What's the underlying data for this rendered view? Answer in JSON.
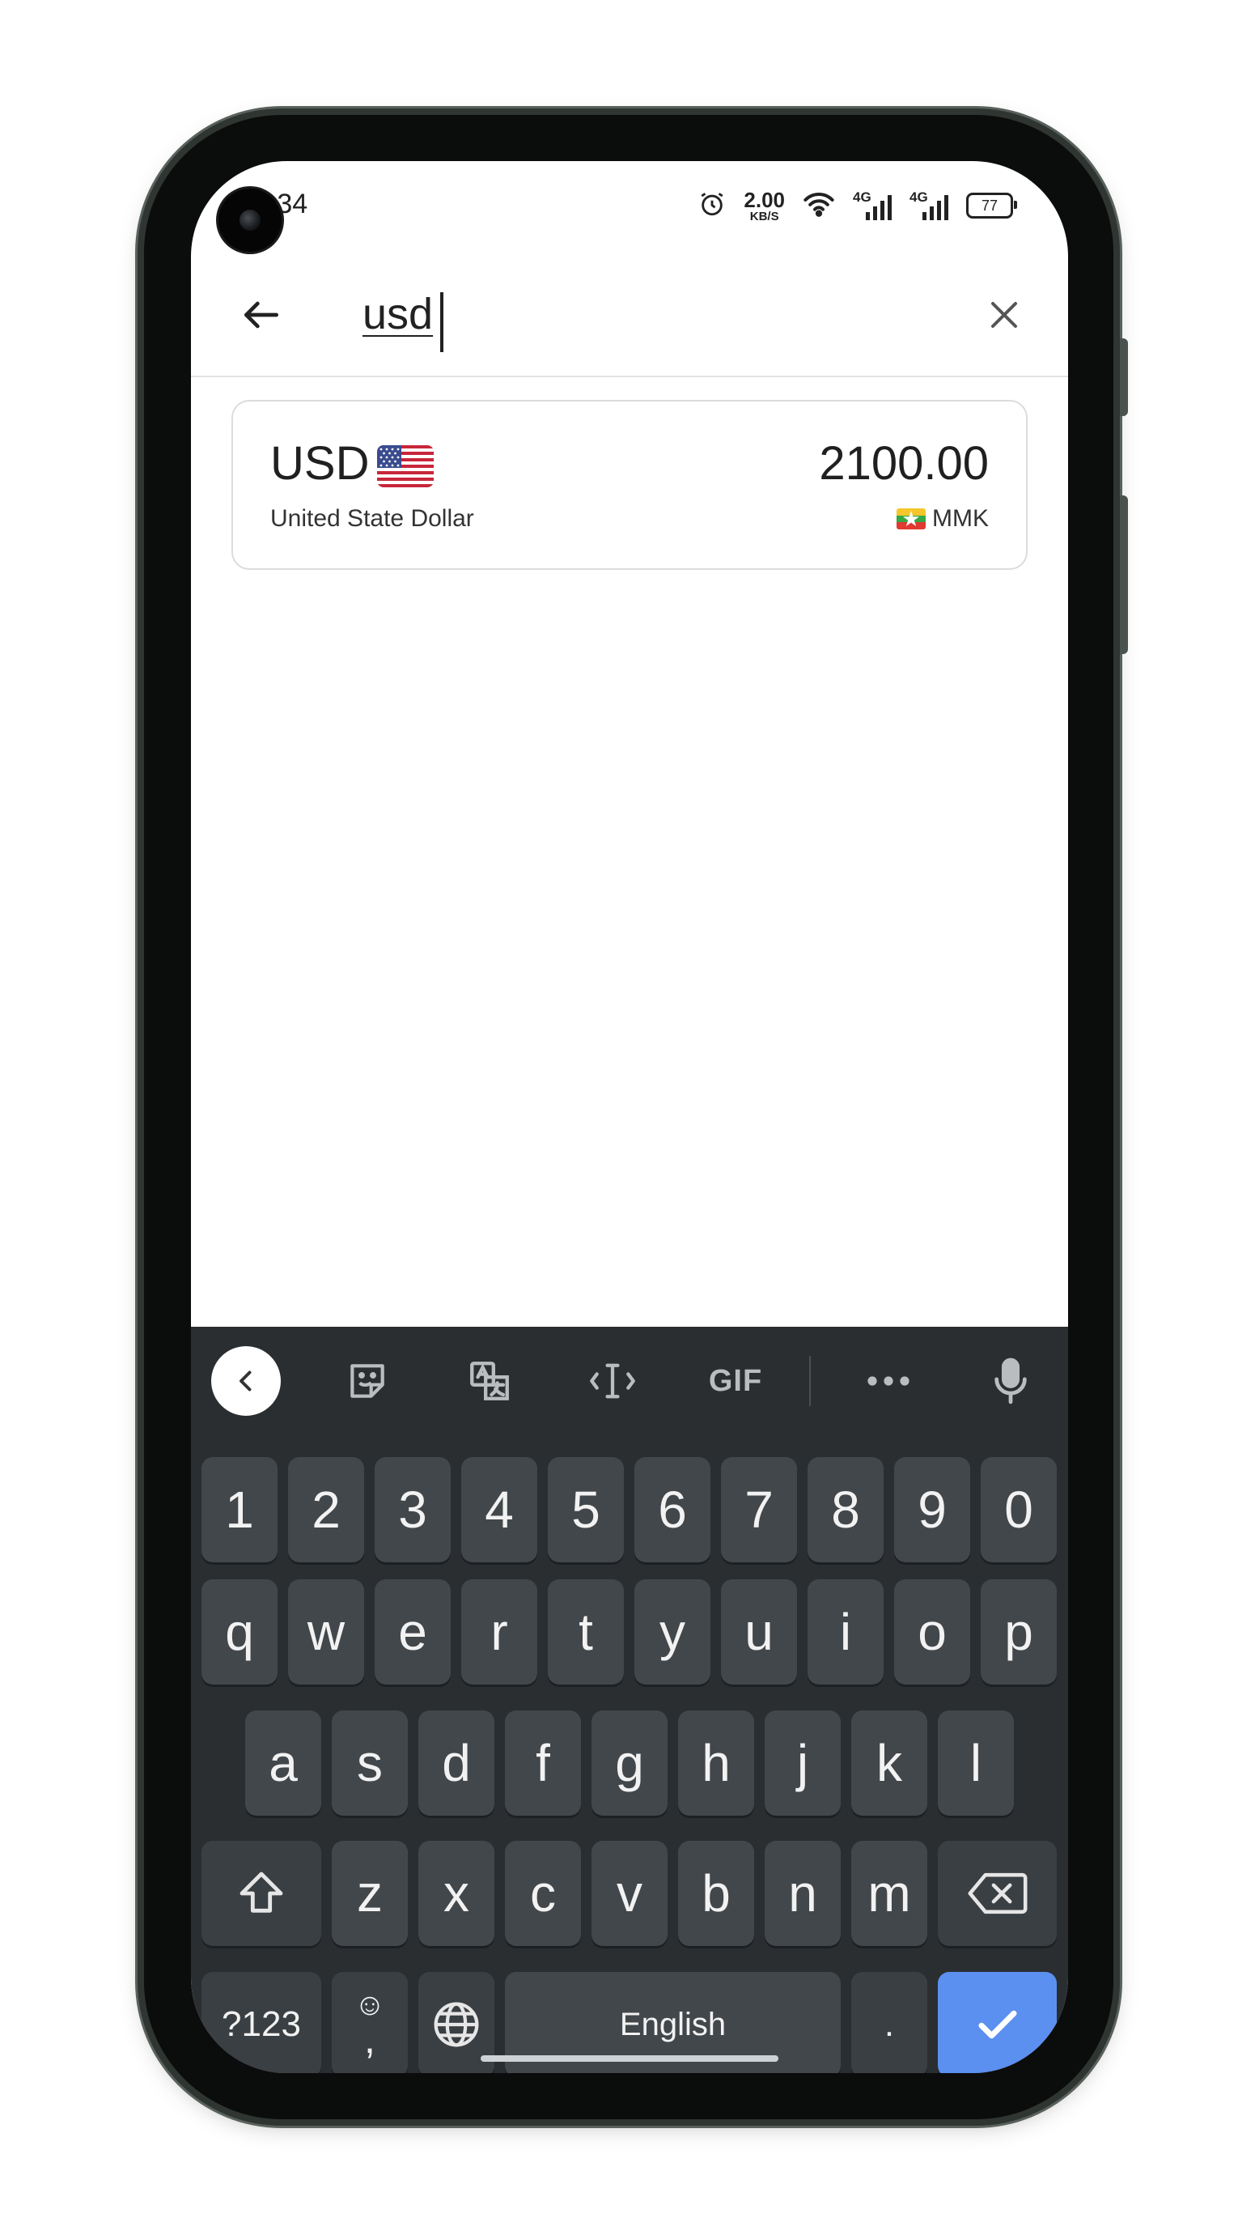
{
  "status_bar": {
    "time": "3:34",
    "net_speed_value": "2.00",
    "net_speed_unit": "KB/S",
    "sim1_label": "4G",
    "sim2_label": "4G",
    "battery": "77"
  },
  "search": {
    "query": "usd"
  },
  "result": {
    "code": "USD",
    "flag_icon": "us-flag-icon",
    "name": "United State Dollar",
    "rate": "2100.00",
    "target_currency": "MMK",
    "target_flag_icon": "myanmar-flag-icon"
  },
  "keyboard": {
    "number_row": [
      "1",
      "2",
      "3",
      "4",
      "5",
      "6",
      "7",
      "8",
      "9",
      "0"
    ],
    "row1": [
      "q",
      "w",
      "e",
      "r",
      "t",
      "y",
      "u",
      "i",
      "o",
      "p"
    ],
    "row2": [
      "a",
      "s",
      "d",
      "f",
      "g",
      "h",
      "j",
      "k",
      "l"
    ],
    "row3": [
      "z",
      "x",
      "c",
      "v",
      "b",
      "n",
      "m"
    ],
    "symbols_label": "?123",
    "comma": ",",
    "space_label": "English",
    "period": ".",
    "toolbar_gif_label": "GIF",
    "colors": {
      "background": "#2a2e31",
      "key": "#42474b",
      "enter": "#5b8ff0"
    }
  }
}
